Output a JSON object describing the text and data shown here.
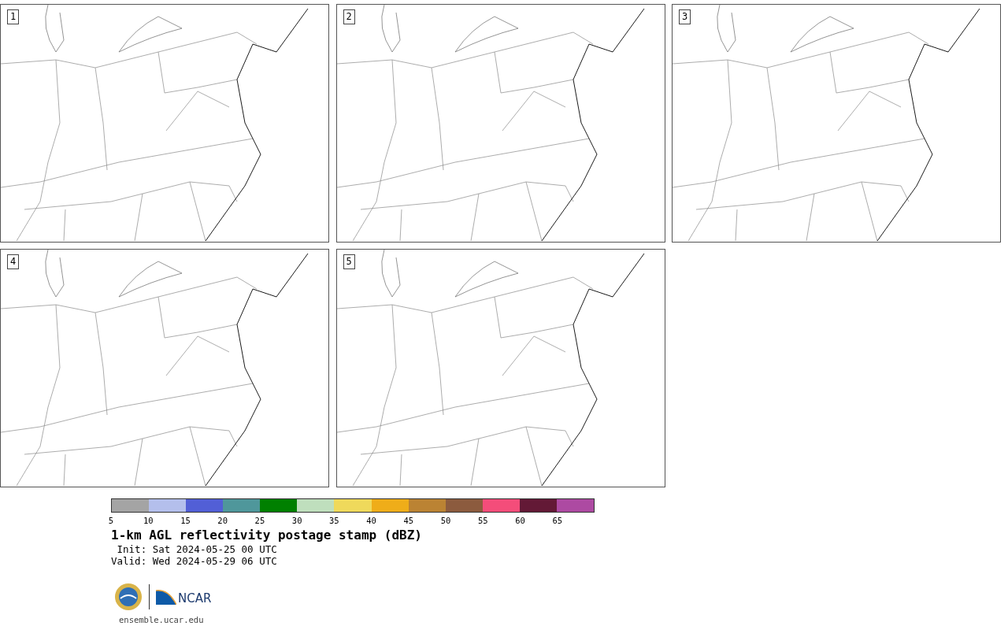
{
  "panels": [
    {
      "label": "1"
    },
    {
      "label": "2"
    },
    {
      "label": "3"
    },
    {
      "label": "4"
    },
    {
      "label": "5"
    }
  ],
  "colorbar": {
    "segments": [
      {
        "color": "#a4a4a4"
      },
      {
        "color": "#b4bfec"
      },
      {
        "color": "#525fd6"
      },
      {
        "color": "#4f979b"
      },
      {
        "color": "#008000"
      },
      {
        "color": "#bfdfbd"
      },
      {
        "color": "#efd95b"
      },
      {
        "color": "#efad19"
      },
      {
        "color": "#bb8333"
      },
      {
        "color": "#8c5b3e"
      },
      {
        "color": "#f44d7a"
      },
      {
        "color": "#631936"
      },
      {
        "color": "#ad4aa2"
      }
    ],
    "ticks": [
      "5",
      "10",
      "15",
      "20",
      "25",
      "30",
      "35",
      "40",
      "45",
      "50",
      "55",
      "60",
      "65"
    ]
  },
  "title": "1-km AGL reflectivity postage stamp (dBZ)",
  "init": " Init: Sat 2024-05-25 00 UTC",
  "valid": "Valid: Wed 2024-05-29 06 UTC",
  "logo_text": "NCAR",
  "url": "ensemble.ucar.edu"
}
